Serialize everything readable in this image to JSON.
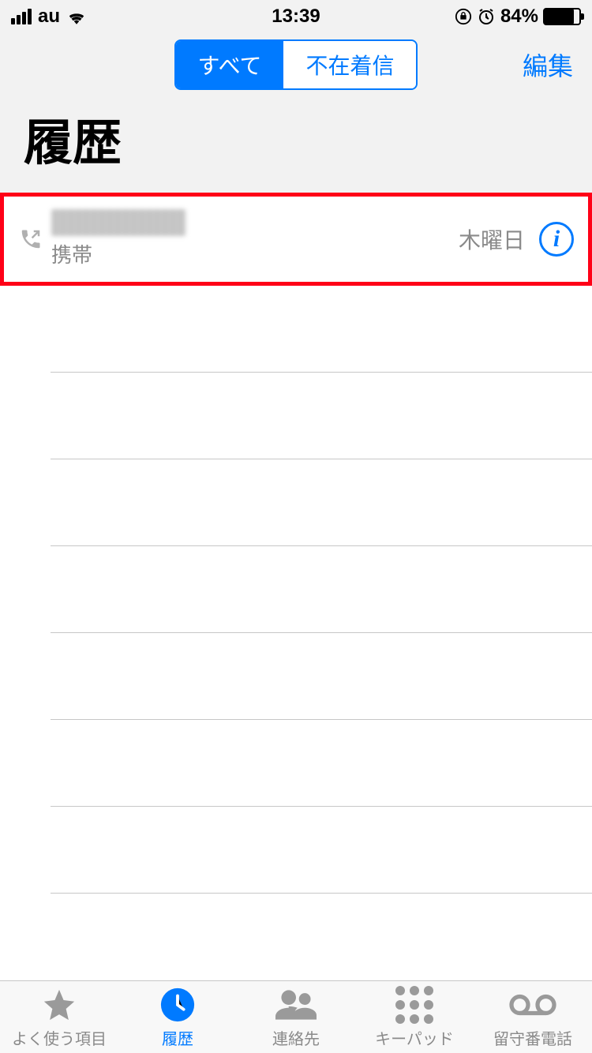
{
  "status": {
    "carrier": "au",
    "time": "13:39",
    "battery_percent": "84%"
  },
  "header": {
    "segment_all": "すべて",
    "segment_missed": "不在着信",
    "edit": "編集",
    "title": "履歴"
  },
  "calls": [
    {
      "type_label": "携帯",
      "time_label": "木曜日"
    }
  ],
  "tabs": {
    "favorites": "よく使う項目",
    "recents": "履歴",
    "contacts": "連絡先",
    "keypad": "キーパッド",
    "voicemail": "留守番電話"
  }
}
